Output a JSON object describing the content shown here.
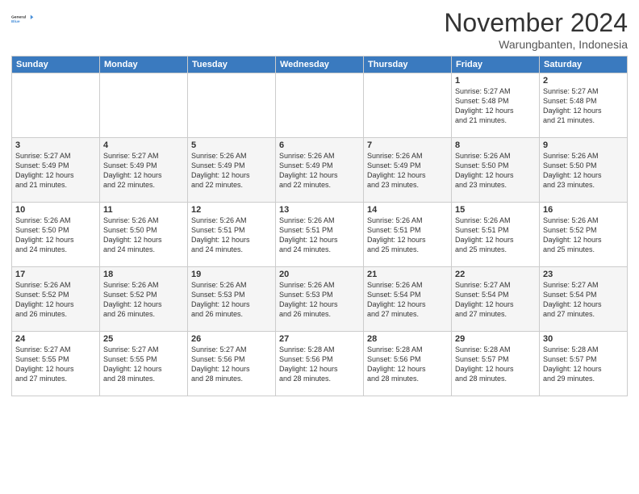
{
  "header": {
    "logo_line1": "General",
    "logo_line2": "Blue",
    "month": "November 2024",
    "location": "Warungbanten, Indonesia"
  },
  "days_of_week": [
    "Sunday",
    "Monday",
    "Tuesday",
    "Wednesday",
    "Thursday",
    "Friday",
    "Saturday"
  ],
  "weeks": [
    [
      {
        "day": "",
        "info": ""
      },
      {
        "day": "",
        "info": ""
      },
      {
        "day": "",
        "info": ""
      },
      {
        "day": "",
        "info": ""
      },
      {
        "day": "",
        "info": ""
      },
      {
        "day": "1",
        "info": "Sunrise: 5:27 AM\nSunset: 5:48 PM\nDaylight: 12 hours\nand 21 minutes."
      },
      {
        "day": "2",
        "info": "Sunrise: 5:27 AM\nSunset: 5:48 PM\nDaylight: 12 hours\nand 21 minutes."
      }
    ],
    [
      {
        "day": "3",
        "info": "Sunrise: 5:27 AM\nSunset: 5:49 PM\nDaylight: 12 hours\nand 21 minutes."
      },
      {
        "day": "4",
        "info": "Sunrise: 5:27 AM\nSunset: 5:49 PM\nDaylight: 12 hours\nand 22 minutes."
      },
      {
        "day": "5",
        "info": "Sunrise: 5:26 AM\nSunset: 5:49 PM\nDaylight: 12 hours\nand 22 minutes."
      },
      {
        "day": "6",
        "info": "Sunrise: 5:26 AM\nSunset: 5:49 PM\nDaylight: 12 hours\nand 22 minutes."
      },
      {
        "day": "7",
        "info": "Sunrise: 5:26 AM\nSunset: 5:49 PM\nDaylight: 12 hours\nand 23 minutes."
      },
      {
        "day": "8",
        "info": "Sunrise: 5:26 AM\nSunset: 5:50 PM\nDaylight: 12 hours\nand 23 minutes."
      },
      {
        "day": "9",
        "info": "Sunrise: 5:26 AM\nSunset: 5:50 PM\nDaylight: 12 hours\nand 23 minutes."
      }
    ],
    [
      {
        "day": "10",
        "info": "Sunrise: 5:26 AM\nSunset: 5:50 PM\nDaylight: 12 hours\nand 24 minutes."
      },
      {
        "day": "11",
        "info": "Sunrise: 5:26 AM\nSunset: 5:50 PM\nDaylight: 12 hours\nand 24 minutes."
      },
      {
        "day": "12",
        "info": "Sunrise: 5:26 AM\nSunset: 5:51 PM\nDaylight: 12 hours\nand 24 minutes."
      },
      {
        "day": "13",
        "info": "Sunrise: 5:26 AM\nSunset: 5:51 PM\nDaylight: 12 hours\nand 24 minutes."
      },
      {
        "day": "14",
        "info": "Sunrise: 5:26 AM\nSunset: 5:51 PM\nDaylight: 12 hours\nand 25 minutes."
      },
      {
        "day": "15",
        "info": "Sunrise: 5:26 AM\nSunset: 5:51 PM\nDaylight: 12 hours\nand 25 minutes."
      },
      {
        "day": "16",
        "info": "Sunrise: 5:26 AM\nSunset: 5:52 PM\nDaylight: 12 hours\nand 25 minutes."
      }
    ],
    [
      {
        "day": "17",
        "info": "Sunrise: 5:26 AM\nSunset: 5:52 PM\nDaylight: 12 hours\nand 26 minutes."
      },
      {
        "day": "18",
        "info": "Sunrise: 5:26 AM\nSunset: 5:52 PM\nDaylight: 12 hours\nand 26 minutes."
      },
      {
        "day": "19",
        "info": "Sunrise: 5:26 AM\nSunset: 5:53 PM\nDaylight: 12 hours\nand 26 minutes."
      },
      {
        "day": "20",
        "info": "Sunrise: 5:26 AM\nSunset: 5:53 PM\nDaylight: 12 hours\nand 26 minutes."
      },
      {
        "day": "21",
        "info": "Sunrise: 5:26 AM\nSunset: 5:54 PM\nDaylight: 12 hours\nand 27 minutes."
      },
      {
        "day": "22",
        "info": "Sunrise: 5:27 AM\nSunset: 5:54 PM\nDaylight: 12 hours\nand 27 minutes."
      },
      {
        "day": "23",
        "info": "Sunrise: 5:27 AM\nSunset: 5:54 PM\nDaylight: 12 hours\nand 27 minutes."
      }
    ],
    [
      {
        "day": "24",
        "info": "Sunrise: 5:27 AM\nSunset: 5:55 PM\nDaylight: 12 hours\nand 27 minutes."
      },
      {
        "day": "25",
        "info": "Sunrise: 5:27 AM\nSunset: 5:55 PM\nDaylight: 12 hours\nand 28 minutes."
      },
      {
        "day": "26",
        "info": "Sunrise: 5:27 AM\nSunset: 5:56 PM\nDaylight: 12 hours\nand 28 minutes."
      },
      {
        "day": "27",
        "info": "Sunrise: 5:28 AM\nSunset: 5:56 PM\nDaylight: 12 hours\nand 28 minutes."
      },
      {
        "day": "28",
        "info": "Sunrise: 5:28 AM\nSunset: 5:56 PM\nDaylight: 12 hours\nand 28 minutes."
      },
      {
        "day": "29",
        "info": "Sunrise: 5:28 AM\nSunset: 5:57 PM\nDaylight: 12 hours\nand 28 minutes."
      },
      {
        "day": "30",
        "info": "Sunrise: 5:28 AM\nSunset: 5:57 PM\nDaylight: 12 hours\nand 29 minutes."
      }
    ]
  ]
}
